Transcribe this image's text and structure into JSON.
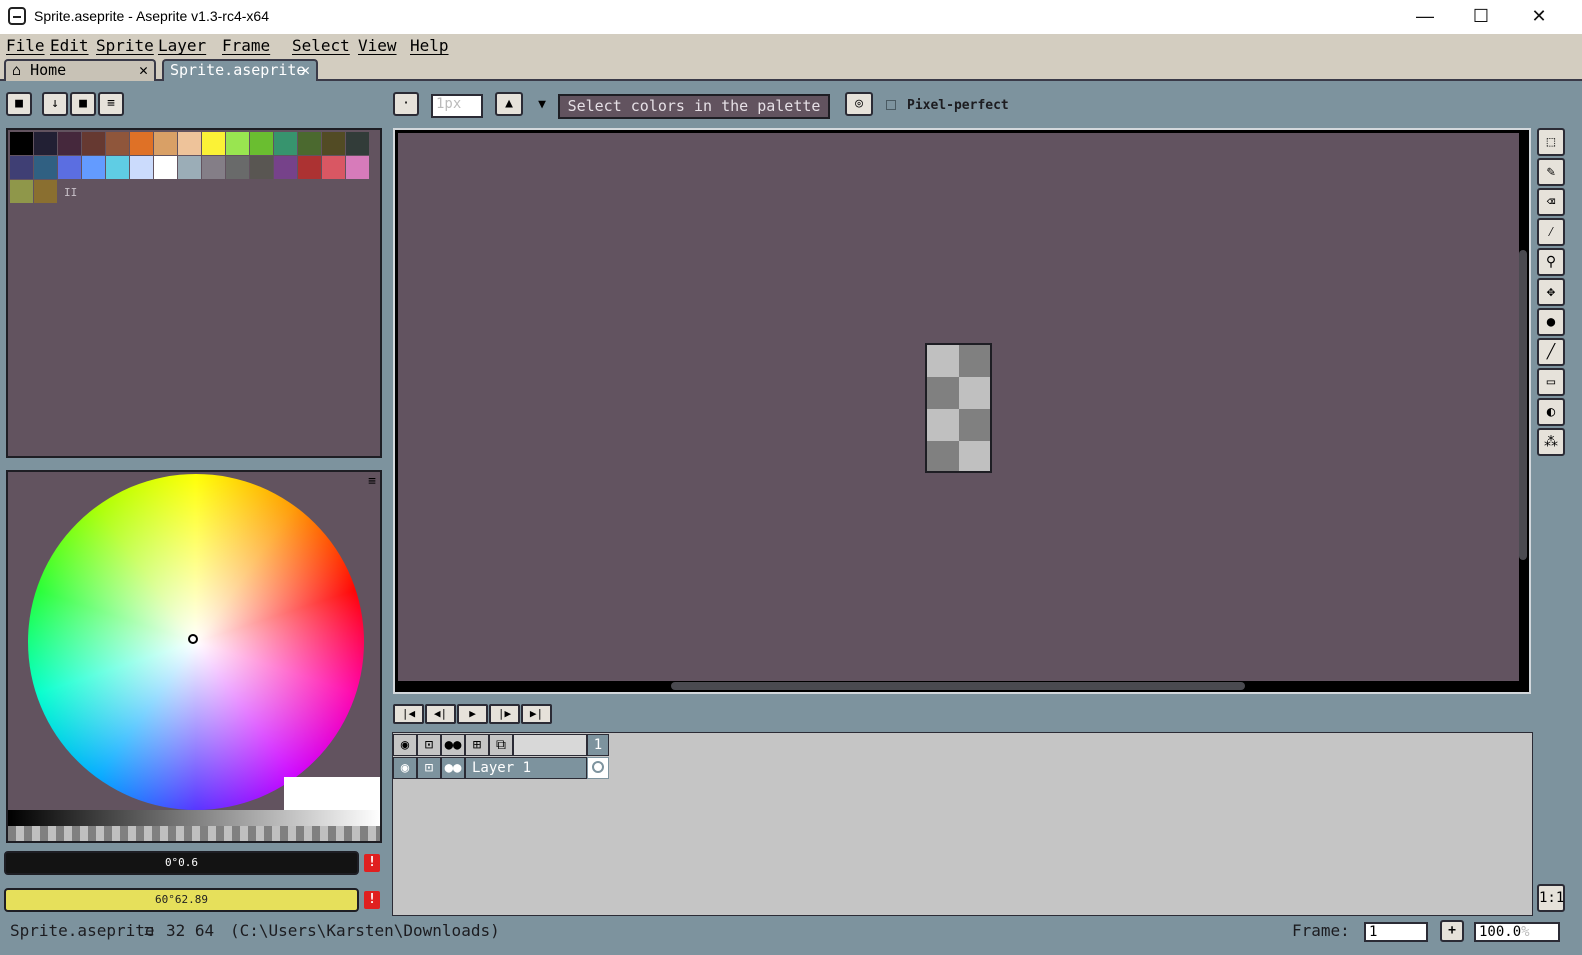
{
  "window": {
    "title": "Sprite.aseprite - Aseprite v1.3-rc4-x64",
    "min": "—",
    "max": "☐",
    "close": "✕"
  },
  "menu": [
    "File",
    "Edit",
    "Sprite",
    "Layer",
    "Frame",
    "Select",
    "View",
    "Help"
  ],
  "tabs": [
    {
      "label": "Home",
      "icon": "home-icon",
      "close": "✕"
    },
    {
      "label": "Sprite.aseprite",
      "close": "✕"
    }
  ],
  "toolbar": {
    "brush_size": "1px",
    "context_text": "Select colors in the palette",
    "pixel_perfect_label": "Pixel-perfect"
  },
  "palette": [
    "#000000",
    "#222034",
    "#45283c",
    "#663931",
    "#8f563b",
    "#df7126",
    "#d9a066",
    "#eec39a",
    "#fbf236",
    "#99e550",
    "#6abe30",
    "#37946e",
    "#4b692f",
    "#524b24",
    "#323c39",
    "#3f3f74",
    "#306082",
    "#5b6ee1",
    "#639bff",
    "#5fcde4",
    "#cbdbfc",
    "#ffffff",
    "#9badb7",
    "#847e87",
    "#696a6a",
    "#595652",
    "#76428a",
    "#ac3232",
    "#d95763",
    "#d77bba",
    "#8f974a",
    "#8a6f30"
  ],
  "colors": {
    "fg_label": "0°0.6",
    "bg_label": "60°62.89",
    "fg": "#131313",
    "bg": "#e6e05b",
    "canvas_bg": "#625360",
    "accent": "#7d939e"
  },
  "timeline": {
    "frame_number": "1",
    "layer_name": "Layer 1"
  },
  "status": {
    "file": "Sprite.aseprite",
    "size": "32 64",
    "path": "(C:\\Users\\Karsten\\Downloads)",
    "frame_label": "Frame:",
    "frame_value": "1",
    "zoom": "100.0",
    "zoom_unit": "%",
    "ratio": "1:1",
    "plus": "+"
  }
}
